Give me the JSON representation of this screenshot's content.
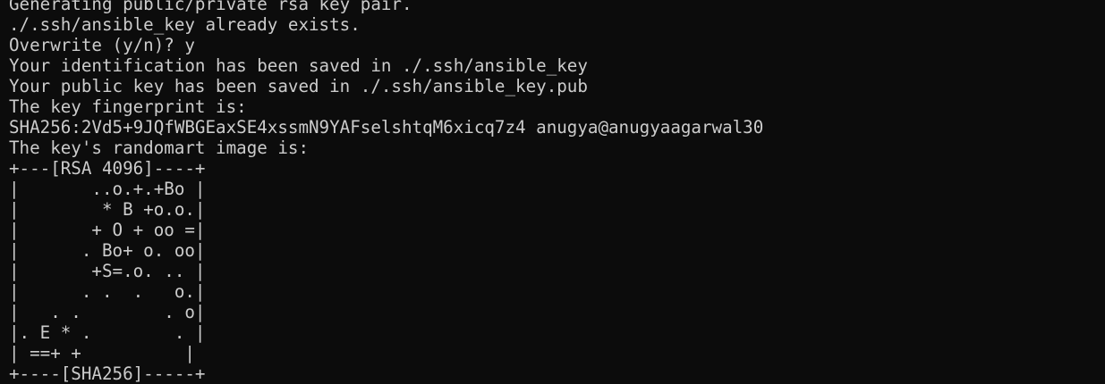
{
  "terminal": {
    "lines": [
      "Generating public/private rsa key pair.",
      "./.ssh/ansible_key already exists.",
      "Overwrite (y/n)? y",
      "Your identification has been saved in ./.ssh/ansible_key",
      "Your public key has been saved in ./.ssh/ansible_key.pub",
      "The key fingerprint is:",
      "SHA256:2Vd5+9JQfWBGEaxSE4xssmN9YAFselshtqM6xicq7z4 anugya@anugyaagarwal30",
      "The key's randomart image is:",
      "+---[RSA 4096]----+",
      "|       ..o.+.+Bo |",
      "|        * B +o.o.|",
      "|       + O + oo =|",
      "|      . Bo+ o. oo|",
      "|       +S=.o. .. |",
      "|      . .  .   o.|",
      "|   . .        . o|",
      "|. E * .        . |",
      "| ==+ +          |",
      "+----[SHA256]-----+"
    ]
  },
  "colors": {
    "background": "#0c0c0c",
    "foreground": "#cccccc"
  }
}
